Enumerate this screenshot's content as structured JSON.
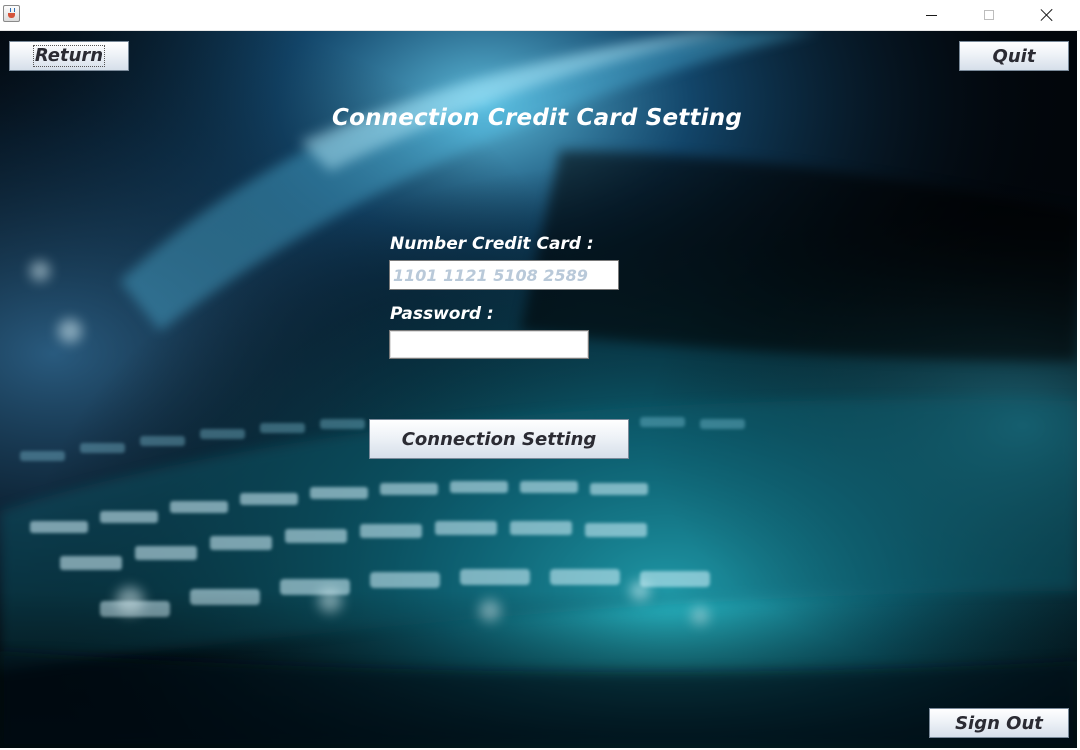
{
  "window": {
    "icon": "java-cup-icon",
    "controls": [
      "minimize-icon",
      "maximize-icon",
      "close-icon"
    ]
  },
  "header": {
    "return_label": "Return",
    "quit_label": "Quit"
  },
  "main": {
    "title": "Connection Credit Card Setting",
    "card_label": "Number Credit Card :",
    "card_placeholder": "1101 1121 5108 2589",
    "password_label": "Password :",
    "password_value": "",
    "connect_label": "Connection Setting"
  },
  "footer": {
    "signout_label": "Sign Out"
  },
  "colors": {
    "background": "#02060b",
    "accent_cyan": "#29c4d6",
    "button_face": "#e4eaf2",
    "label_text": "#ffffff",
    "placeholder_text": "#b9c9d9"
  }
}
